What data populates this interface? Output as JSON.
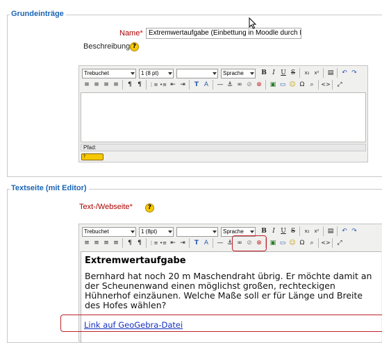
{
  "section1": {
    "legend": "Grundeinträge",
    "name_label": "Name",
    "required_star": "*",
    "name_value": "Extremwertaufgabe (Einbettung in Moodle durch Link",
    "description_label": "Beschreibung",
    "help_glyph": "?",
    "editor": {
      "font_select": "Trebuchet",
      "size_select": "1 (8 pt)",
      "format_select": "",
      "language_select": "Sprache",
      "path_label": "Pfad:",
      "help_button_label": "?"
    }
  },
  "section2": {
    "legend": "Textseite (mit Editor)",
    "text_label": "Text-/Webseite",
    "required_star": "*",
    "help_glyph": "?",
    "editor": {
      "font_select": "Trebuchet",
      "size_select": "1 (8pt)",
      "format_select": "",
      "language_select": "Sprache",
      "content_heading": "Extremwertaufgabe",
      "content_paragraph": "Bernhard hat noch 20 m Maschendraht übrig. Er möchte damit an der Scheunenwand einen möglichst großen, rechteckigen Hühnerhof einzäunen. Welche Maße soll er für Länge und Breite des Hofes wählen?",
      "content_link": "Link auf GeoGebra-Datei"
    }
  },
  "toolbar_glyphs": {
    "bold": "B",
    "italic": "I",
    "underline": "U",
    "strike": "S",
    "subscript": "x₂",
    "superscript": "x²",
    "paste": "▤",
    "undo": "↶",
    "redo": "↷",
    "align_left": "≡",
    "align_center": "≡",
    "align_right": "≡",
    "justify": "≡",
    "ltr": "¶",
    "rtl": "¶",
    "ordered_list": "⋮≡",
    "unordered_list": "•≡",
    "outdent": "⇤",
    "indent": "⇥",
    "text_color": "T",
    "bg_color": "A",
    "hr": "—",
    "anchor": "⚓",
    "link": "∞",
    "unlink": "⊘",
    "nolink": "⊗",
    "image": "▣",
    "table": "▭",
    "smiley": "☺",
    "special_char": "Ω",
    "search": "⌕",
    "html": "<>",
    "fullscreen": "⤢"
  },
  "colors": {
    "legend": "#1a64b4",
    "required": "#aa0000",
    "highlight": "#c0202a",
    "link": "#1530c0"
  }
}
